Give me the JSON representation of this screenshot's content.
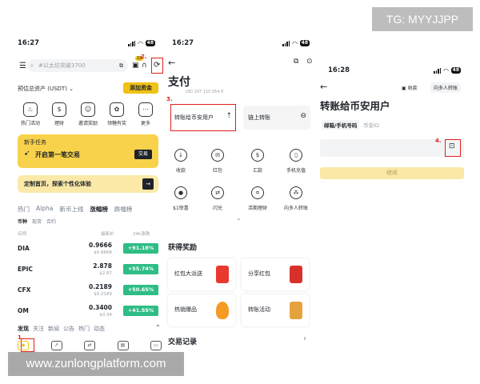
{
  "watermark": {
    "tg": "TG: MYYJJPP",
    "url": "www.zunlongplatform.com"
  },
  "steps": {
    "s1": "1.",
    "s2": "2.",
    "s3": "3.",
    "s4": "4."
  },
  "screen1": {
    "time": "16:27",
    "battery": "48",
    "search_placeholder": "#以太坊突破3700",
    "badge": "19",
    "assets_label": "预估总资产 (USDT)",
    "add_funds": "添加资金",
    "quick": [
      "热门活动",
      "理财",
      "邀请奖励",
      "领糖有奖",
      "更多"
    ],
    "newbie_title": "新手任务",
    "newbie_text": "开启第一笔交易",
    "newbie_btn": "交易",
    "custom_text": "定制首页，探索个性化体验",
    "tabs": [
      "热门",
      "Alpha",
      "新币上线",
      "涨幅榜",
      "跌幅榜"
    ],
    "subtabs": [
      "币种",
      "现货",
      "合约"
    ],
    "col_name": "名称",
    "col_price": "最新价",
    "col_change": "24h涨跌",
    "rows": [
      {
        "sym": "DIA",
        "price": "0.9666",
        "sub": "$0.9666",
        "chg": "+91.18%"
      },
      {
        "sym": "EPIC",
        "price": "2.878",
        "sub": "$2.87",
        "chg": "+55.74%"
      },
      {
        "sym": "CFX",
        "price": "0.2189",
        "sub": "$0.2189",
        "chg": "+50.65%"
      },
      {
        "sym": "OM",
        "price": "0.3400",
        "sub": "$0.34",
        "chg": "+41.55%"
      }
    ],
    "feed_tabs": [
      "发现",
      "关注",
      "新闻",
      "公告",
      "热门",
      "动态"
    ]
  },
  "screen2": {
    "time": "16:27",
    "battery": "48",
    "title": "支付",
    "uid": "UID 107 110 054 8",
    "transfer_user": "转账给币安用户",
    "onchain": "链上转账",
    "services_row1": [
      "收款",
      "红包",
      "汇款",
      "手机充值"
    ],
    "services_row2": [
      "$1惊喜",
      "闪兑",
      "活期理财",
      "向多人转账"
    ],
    "rewards_title": "获得奖励",
    "rewards": [
      "红包大派送",
      "分享红包",
      "热销爆品",
      "转账活动"
    ],
    "records_title": "交易记录"
  },
  "screen3": {
    "time": "16:28",
    "battery": "48",
    "btn_receive": "收款",
    "btn_multi": "向多人转账",
    "title": "转账给币安用户",
    "tab_email": "邮箱/手机号码",
    "tab_id": "币安ID",
    "continue": "继续"
  }
}
